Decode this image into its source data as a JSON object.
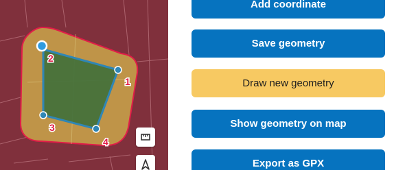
{
  "colors": {
    "map_background": "#7a2f3a",
    "buffer_fill": "#c7a24a",
    "buffer_outline": "#e11d48",
    "polygon_fill": "#3f6f3a",
    "polygon_stroke": "#2f86b5",
    "vertex_color": "#2f86b5",
    "selected_vertex": "#2f9be0",
    "label_color": "#e11d48",
    "primary_button": "#0673bf",
    "active_button": "#f7c962"
  },
  "map": {
    "vertices": [
      {
        "label": "1"
      },
      {
        "label": "2"
      },
      {
        "label": "3"
      },
      {
        "label": "4"
      }
    ],
    "controls": {
      "measure_icon": "ruler-icon",
      "north_icon": "north-arrow-icon"
    }
  },
  "actions": {
    "add_coordinate": "Add coordinate",
    "save_geometry": "Save geometry",
    "draw_new_geometry": "Draw new geometry",
    "show_geometry_on_map": "Show geometry on map",
    "export_gpx": "Export as GPX"
  }
}
